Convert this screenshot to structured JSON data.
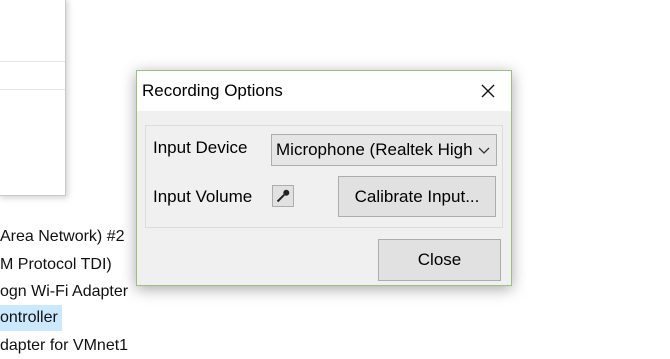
{
  "background_list": {
    "items": [
      {
        "label": "Area Network) #2",
        "selected": false
      },
      {
        "label": "M Protocol TDI)",
        "selected": false
      },
      {
        "label": "ogn Wi-Fi Adapter",
        "selected": false
      },
      {
        "label": "ontroller",
        "selected": true
      },
      {
        "label": "dapter for VMnet1",
        "selected": false
      }
    ]
  },
  "dialog": {
    "title": "Recording Options",
    "input_device_label": "Input Device",
    "input_device_value": "Microphone (Realtek High",
    "input_volume_label": "Input Volume",
    "calibrate_label": "Calibrate Input...",
    "close_label": "Close"
  },
  "icons": {
    "close": "close-x-icon",
    "dropdown": "chevron-down-icon",
    "microphone": "microphone-icon"
  },
  "colors": {
    "selection": "#cce8ff",
    "dialog_border": "#9cc07e",
    "dialog_bg": "#f0f0f0",
    "button_bg": "#e1e1e1"
  }
}
